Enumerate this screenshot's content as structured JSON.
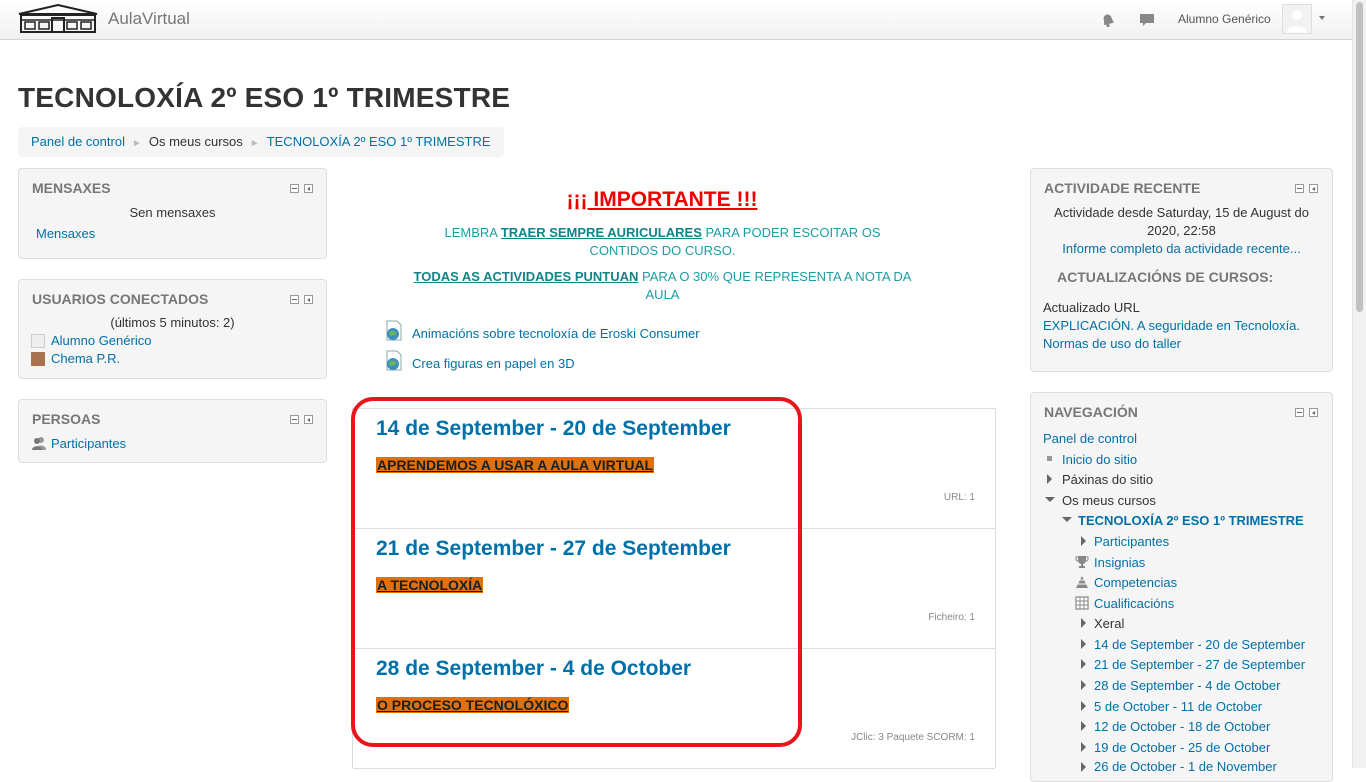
{
  "navbar": {
    "brand": "AulaVirtual",
    "username": "Alumno Genérico",
    "icons": {
      "logo": "school-building-logo",
      "notifications": "bell-icon",
      "messages": "chat-bubble-icon",
      "user_menu": "chevron-down-icon"
    }
  },
  "page": {
    "title": "TECNOLOXÍA 2º ESO 1º TRIMESTRE",
    "breadcrumb": [
      {
        "label": "Panel de control"
      },
      {
        "label": "Os meus cursos"
      },
      {
        "label": "TECNOLOXÍA 2º ESO 1º TRIMESTRE"
      }
    ]
  },
  "left_blocks": {
    "messages": {
      "title": "MENSAXES",
      "empty_text": "Sen mensaxes",
      "link": "Mensaxes"
    },
    "online_users": {
      "title": "USUARIOS CONECTADOS",
      "period": "(últimos 5 minutos: 2)",
      "users": [
        {
          "name": "Alumno Genérico"
        },
        {
          "name": "Chema P.R."
        }
      ]
    },
    "people": {
      "title": "PERSOAS",
      "link": "Participantes"
    }
  },
  "main": {
    "important_heading": "¡¡¡ IMPORTANTE !!!",
    "notice1": {
      "before": "LEMBRA ",
      "bold": "TRAER SEMPRE AURICULARES",
      "after": " PARA PODER ESCOITAR OS CONTIDOS DO CURSO."
    },
    "notice2": {
      "bold": "TODAS AS ACTIVIDADES PUNTUAN",
      "after": " PARA O 30% QUE REPRESENTA A NOTA DA AULA"
    },
    "resources": [
      {
        "label": "Animacións sobre tecnoloxía de Eroski Consumer"
      },
      {
        "label": "Crea figuras en papel en 3D"
      }
    ],
    "sections": [
      {
        "title": "14 de September - 20 de September",
        "topic": "APRENDEMOS A USAR A AULA VIRTUAL",
        "summary": "URL: 1"
      },
      {
        "title": "21 de September - 27 de September",
        "topic": "A TECNOLOXÍA",
        "summary": "Ficheiro: 1"
      },
      {
        "title": "28 de September - 4 de October",
        "topic": "O PROCESO TECNOLÓXICO",
        "summary": "JClic: 3  Paquete SCORM: 1"
      }
    ]
  },
  "right_blocks": {
    "recent_activity": {
      "title": "ACTIVIDADE RECENTE",
      "since_line1": "Actividade desde Saturday, 15 de August do",
      "since_line2": "2020, 22:58",
      "full_report_link": "Informe completo da actividade recente...",
      "updates_heading": "ACTUALIZACIÓNS DE CURSOS:",
      "update_type": "Actualizado URL",
      "update_links": [
        "EXPLICACIÓN. A seguridade en Tecnoloxía.",
        "Normas de uso do taller"
      ]
    },
    "navigation": {
      "title": "NAVEGACIÓN",
      "dashboard": "Panel de control",
      "home": "Inicio do sitio",
      "site_pages": "Páxinas do sitio",
      "my_courses": "Os meus cursos",
      "current_course": "TECNOLOXÍA 2º ESO 1º TRIMESTRE",
      "course_items": [
        "Participantes",
        "Insignias",
        "Competencias",
        "Cualificacións",
        "Xeral"
      ],
      "weeks": [
        "14 de September - 20 de September",
        "21 de September - 27 de September",
        "28 de September - 4 de October",
        "5 de October - 11 de October",
        "12 de October - 18 de October",
        "19 de October - 25 de October",
        "26 de October - 1 de November"
      ]
    }
  },
  "colors": {
    "link": "#0070a8",
    "important": "#e00000",
    "notice": "#1d9ca3",
    "topic_bg": "#e16f0a",
    "highlight": "#e8151b"
  }
}
